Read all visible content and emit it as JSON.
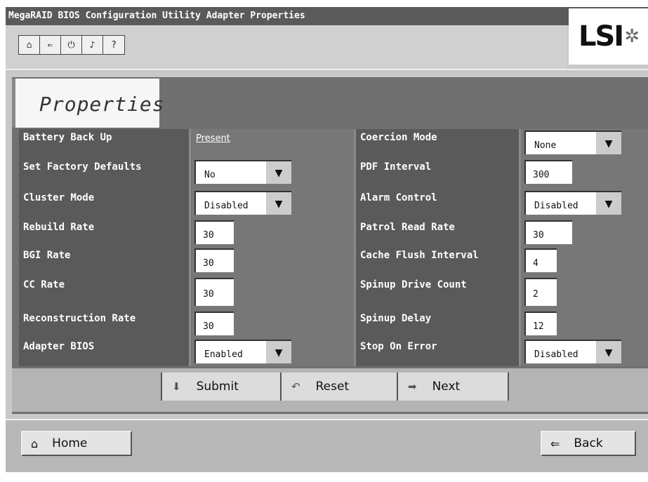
{
  "window": {
    "title": "MegaRAID BIOS Configuration Utility Adapter Properties"
  },
  "toolbar": {
    "icons": [
      "home-icon",
      "back-icon",
      "exit-icon",
      "sound-icon",
      "help-icon"
    ],
    "glyphs": [
      "⌂",
      "⇐",
      "⏻",
      "♪",
      "?"
    ]
  },
  "logo": {
    "text": "LSI"
  },
  "tab": {
    "label": "Properties"
  },
  "properties": {
    "battery_back_up": {
      "label": "Battery Back Up",
      "value": "Present"
    },
    "set_factory_defaults": {
      "label": "Set Factory Defaults",
      "value": "No"
    },
    "cluster_mode": {
      "label": "Cluster Mode",
      "value": "Disabled"
    },
    "rebuild_rate": {
      "label": "Rebuild Rate",
      "value": "30"
    },
    "bgi_rate": {
      "label": "BGI Rate",
      "value": "30"
    },
    "cc_rate": {
      "label": "CC Rate",
      "value": "30"
    },
    "reconstruction_rate": {
      "label": "Reconstruction Rate",
      "value": "30"
    },
    "adapter_bios": {
      "label": "Adapter BIOS",
      "value": "Enabled"
    },
    "coercion_mode": {
      "label": "Coercion Mode",
      "value": "None"
    },
    "pdf_interval": {
      "label": "PDF Interval",
      "value": "300"
    },
    "alarm_control": {
      "label": "Alarm Control",
      "value": "Disabled"
    },
    "patrol_read_rate": {
      "label": "Patrol Read Rate",
      "value": "30"
    },
    "cache_flush_interval": {
      "label": "Cache Flush Interval",
      "value": "4"
    },
    "spinup_drive_count": {
      "label": "Spinup Drive Count",
      "value": "2"
    },
    "spinup_delay": {
      "label": "Spinup Delay",
      "value": "12"
    },
    "stop_on_error": {
      "label": "Stop On Error",
      "value": "Disabled"
    }
  },
  "actions": {
    "submit": "Submit",
    "reset": "Reset",
    "next": "Next"
  },
  "footer": {
    "home": "Home",
    "back": "Back"
  }
}
